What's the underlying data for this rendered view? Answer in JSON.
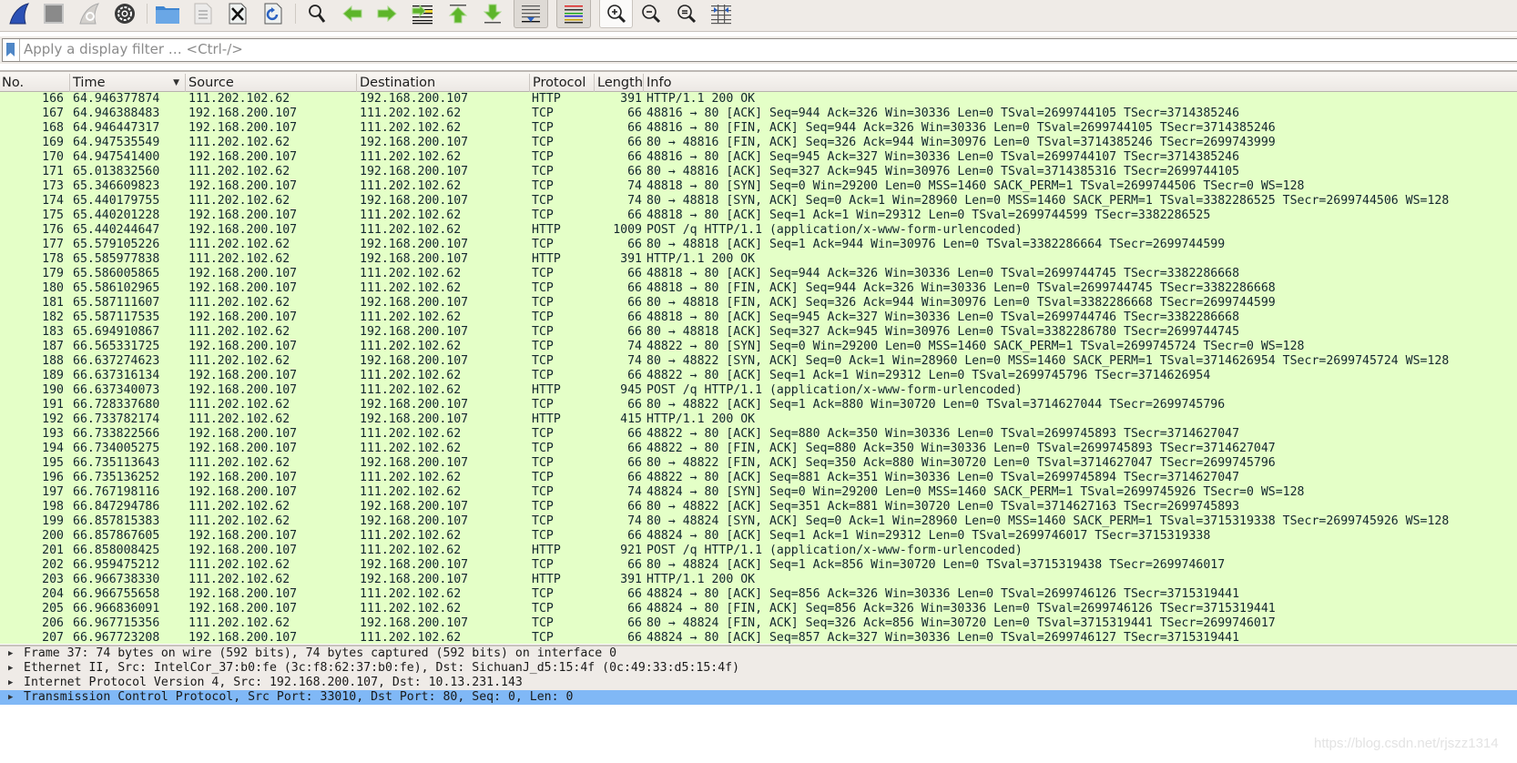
{
  "toolbar": {
    "buttons": [
      {
        "name": "start-capture",
        "icon": "shark-fin-icon"
      },
      {
        "name": "stop-capture",
        "icon": "stop-square-icon"
      },
      {
        "name": "restart-capture",
        "icon": "restart-fin-icon"
      },
      {
        "name": "capture-options",
        "icon": "gear-icon"
      },
      {
        "name": "open-file",
        "icon": "folder-icon"
      },
      {
        "name": "save-file",
        "icon": "binary-file-icon"
      },
      {
        "name": "close-file",
        "icon": "close-file-icon"
      },
      {
        "name": "reload-file",
        "icon": "reload-file-icon"
      },
      {
        "name": "find-packet",
        "icon": "search-icon"
      },
      {
        "name": "go-back",
        "icon": "arrow-left-icon"
      },
      {
        "name": "go-forward",
        "icon": "arrow-right-icon"
      },
      {
        "name": "go-to-packet",
        "icon": "goto-packet-icon"
      },
      {
        "name": "go-first",
        "icon": "arrow-up-icon"
      },
      {
        "name": "go-last",
        "icon": "arrow-down-icon"
      },
      {
        "name": "auto-scroll",
        "icon": "autoscroll-icon"
      },
      {
        "name": "colorize",
        "icon": "colorize-lines-icon"
      },
      {
        "name": "zoom-in",
        "icon": "zoom-in-icon"
      },
      {
        "name": "zoom-out",
        "icon": "zoom-out-icon"
      },
      {
        "name": "normal-size",
        "icon": "zoom-reset-icon"
      },
      {
        "name": "resize-columns",
        "icon": "resize-columns-icon"
      }
    ]
  },
  "filter": {
    "placeholder": "Apply a display filter … <Ctrl-/>",
    "value": ""
  },
  "packet_list": {
    "columns": [
      "No.",
      "Time",
      "Source",
      "Destination",
      "Protocol",
      "Length",
      "Info"
    ],
    "sort_column": "Time",
    "row_color": "#e4ffc7",
    "rows": [
      {
        "no": "166",
        "time": "64.946377874",
        "src": "111.202.102.62",
        "dst": "192.168.200.107",
        "proto": "HTTP",
        "len": "391",
        "info": "HTTP/1.1 200 OK"
      },
      {
        "no": "167",
        "time": "64.946388483",
        "src": "192.168.200.107",
        "dst": "111.202.102.62",
        "proto": "TCP",
        "len": "66",
        "info": "48816 → 80 [ACK] Seq=944 Ack=326 Win=30336 Len=0 TSval=2699744105 TSecr=3714385246"
      },
      {
        "no": "168",
        "time": "64.946447317",
        "src": "192.168.200.107",
        "dst": "111.202.102.62",
        "proto": "TCP",
        "len": "66",
        "info": "48816 → 80 [FIN, ACK] Seq=944 Ack=326 Win=30336 Len=0 TSval=2699744105 TSecr=3714385246"
      },
      {
        "no": "169",
        "time": "64.947535549",
        "src": "111.202.102.62",
        "dst": "192.168.200.107",
        "proto": "TCP",
        "len": "66",
        "info": "80 → 48816 [FIN, ACK] Seq=326 Ack=944 Win=30976 Len=0 TSval=3714385246 TSecr=2699743999"
      },
      {
        "no": "170",
        "time": "64.947541400",
        "src": "192.168.200.107",
        "dst": "111.202.102.62",
        "proto": "TCP",
        "len": "66",
        "info": "48816 → 80 [ACK] Seq=945 Ack=327 Win=30336 Len=0 TSval=2699744107 TSecr=3714385246"
      },
      {
        "no": "171",
        "time": "65.013832560",
        "src": "111.202.102.62",
        "dst": "192.168.200.107",
        "proto": "TCP",
        "len": "66",
        "info": "80 → 48816 [ACK] Seq=327 Ack=945 Win=30976 Len=0 TSval=3714385316 TSecr=2699744105"
      },
      {
        "no": "173",
        "time": "65.346609823",
        "src": "192.168.200.107",
        "dst": "111.202.102.62",
        "proto": "TCP",
        "len": "74",
        "info": "48818 → 80 [SYN] Seq=0 Win=29200 Len=0 MSS=1460 SACK_PERM=1 TSval=2699744506 TSecr=0 WS=128"
      },
      {
        "no": "174",
        "time": "65.440179755",
        "src": "111.202.102.62",
        "dst": "192.168.200.107",
        "proto": "TCP",
        "len": "74",
        "info": "80 → 48818 [SYN, ACK] Seq=0 Ack=1 Win=28960 Len=0 MSS=1460 SACK_PERM=1 TSval=3382286525 TSecr=2699744506 WS=128"
      },
      {
        "no": "175",
        "time": "65.440201228",
        "src": "192.168.200.107",
        "dst": "111.202.102.62",
        "proto": "TCP",
        "len": "66",
        "info": "48818 → 80 [ACK] Seq=1 Ack=1 Win=29312 Len=0 TSval=2699744599 TSecr=3382286525"
      },
      {
        "no": "176",
        "time": "65.440244647",
        "src": "192.168.200.107",
        "dst": "111.202.102.62",
        "proto": "HTTP",
        "len": "1009",
        "info": "POST /q HTTP/1.1  (application/x-www-form-urlencoded)"
      },
      {
        "no": "177",
        "time": "65.579105226",
        "src": "111.202.102.62",
        "dst": "192.168.200.107",
        "proto": "TCP",
        "len": "66",
        "info": "80 → 48818 [ACK] Seq=1 Ack=944 Win=30976 Len=0 TSval=3382286664 TSecr=2699744599"
      },
      {
        "no": "178",
        "time": "65.585977838",
        "src": "111.202.102.62",
        "dst": "192.168.200.107",
        "proto": "HTTP",
        "len": "391",
        "info": "HTTP/1.1 200 OK"
      },
      {
        "no": "179",
        "time": "65.586005865",
        "src": "192.168.200.107",
        "dst": "111.202.102.62",
        "proto": "TCP",
        "len": "66",
        "info": "48818 → 80 [ACK] Seq=944 Ack=326 Win=30336 Len=0 TSval=2699744745 TSecr=3382286668"
      },
      {
        "no": "180",
        "time": "65.586102965",
        "src": "192.168.200.107",
        "dst": "111.202.102.62",
        "proto": "TCP",
        "len": "66",
        "info": "48818 → 80 [FIN, ACK] Seq=944 Ack=326 Win=30336 Len=0 TSval=2699744745 TSecr=3382286668"
      },
      {
        "no": "181",
        "time": "65.587111607",
        "src": "111.202.102.62",
        "dst": "192.168.200.107",
        "proto": "TCP",
        "len": "66",
        "info": "80 → 48818 [FIN, ACK] Seq=326 Ack=944 Win=30976 Len=0 TSval=3382286668 TSecr=2699744599"
      },
      {
        "no": "182",
        "time": "65.587117535",
        "src": "192.168.200.107",
        "dst": "111.202.102.62",
        "proto": "TCP",
        "len": "66",
        "info": "48818 → 80 [ACK] Seq=945 Ack=327 Win=30336 Len=0 TSval=2699744746 TSecr=3382286668"
      },
      {
        "no": "183",
        "time": "65.694910867",
        "src": "111.202.102.62",
        "dst": "192.168.200.107",
        "proto": "TCP",
        "len": "66",
        "info": "80 → 48818 [ACK] Seq=327 Ack=945 Win=30976 Len=0 TSval=3382286780 TSecr=2699744745"
      },
      {
        "no": "187",
        "time": "66.565331725",
        "src": "192.168.200.107",
        "dst": "111.202.102.62",
        "proto": "TCP",
        "len": "74",
        "info": "48822 → 80 [SYN] Seq=0 Win=29200 Len=0 MSS=1460 SACK_PERM=1 TSval=2699745724 TSecr=0 WS=128"
      },
      {
        "no": "188",
        "time": "66.637274623",
        "src": "111.202.102.62",
        "dst": "192.168.200.107",
        "proto": "TCP",
        "len": "74",
        "info": "80 → 48822 [SYN, ACK] Seq=0 Ack=1 Win=28960 Len=0 MSS=1460 SACK_PERM=1 TSval=3714626954 TSecr=2699745724 WS=128"
      },
      {
        "no": "189",
        "time": "66.637316134",
        "src": "192.168.200.107",
        "dst": "111.202.102.62",
        "proto": "TCP",
        "len": "66",
        "info": "48822 → 80 [ACK] Seq=1 Ack=1 Win=29312 Len=0 TSval=2699745796 TSecr=3714626954"
      },
      {
        "no": "190",
        "time": "66.637340073",
        "src": "192.168.200.107",
        "dst": "111.202.102.62",
        "proto": "HTTP",
        "len": "945",
        "info": "POST /q HTTP/1.1  (application/x-www-form-urlencoded)"
      },
      {
        "no": "191",
        "time": "66.728337680",
        "src": "111.202.102.62",
        "dst": "192.168.200.107",
        "proto": "TCP",
        "len": "66",
        "info": "80 → 48822 [ACK] Seq=1 Ack=880 Win=30720 Len=0 TSval=3714627044 TSecr=2699745796"
      },
      {
        "no": "192",
        "time": "66.733782174",
        "src": "111.202.102.62",
        "dst": "192.168.200.107",
        "proto": "HTTP",
        "len": "415",
        "info": "HTTP/1.1 200 OK"
      },
      {
        "no": "193",
        "time": "66.733822566",
        "src": "192.168.200.107",
        "dst": "111.202.102.62",
        "proto": "TCP",
        "len": "66",
        "info": "48822 → 80 [ACK] Seq=880 Ack=350 Win=30336 Len=0 TSval=2699745893 TSecr=3714627047"
      },
      {
        "no": "194",
        "time": "66.734005275",
        "src": "192.168.200.107",
        "dst": "111.202.102.62",
        "proto": "TCP",
        "len": "66",
        "info": "48822 → 80 [FIN, ACK] Seq=880 Ack=350 Win=30336 Len=0 TSval=2699745893 TSecr=3714627047"
      },
      {
        "no": "195",
        "time": "66.735113643",
        "src": "111.202.102.62",
        "dst": "192.168.200.107",
        "proto": "TCP",
        "len": "66",
        "info": "80 → 48822 [FIN, ACK] Seq=350 Ack=880 Win=30720 Len=0 TSval=3714627047 TSecr=2699745796"
      },
      {
        "no": "196",
        "time": "66.735136252",
        "src": "192.168.200.107",
        "dst": "111.202.102.62",
        "proto": "TCP",
        "len": "66",
        "info": "48822 → 80 [ACK] Seq=881 Ack=351 Win=30336 Len=0 TSval=2699745894 TSecr=3714627047"
      },
      {
        "no": "197",
        "time": "66.767198116",
        "src": "192.168.200.107",
        "dst": "111.202.102.62",
        "proto": "TCP",
        "len": "74",
        "info": "48824 → 80 [SYN] Seq=0 Win=29200 Len=0 MSS=1460 SACK_PERM=1 TSval=2699745926 TSecr=0 WS=128"
      },
      {
        "no": "198",
        "time": "66.847294786",
        "src": "111.202.102.62",
        "dst": "192.168.200.107",
        "proto": "TCP",
        "len": "66",
        "info": "80 → 48822 [ACK] Seq=351 Ack=881 Win=30720 Len=0 TSval=3714627163 TSecr=2699745893"
      },
      {
        "no": "199",
        "time": "66.857815383",
        "src": "111.202.102.62",
        "dst": "192.168.200.107",
        "proto": "TCP",
        "len": "74",
        "info": "80 → 48824 [SYN, ACK] Seq=0 Ack=1 Win=28960 Len=0 MSS=1460 SACK_PERM=1 TSval=3715319338 TSecr=2699745926 WS=128"
      },
      {
        "no": "200",
        "time": "66.857867605",
        "src": "192.168.200.107",
        "dst": "111.202.102.62",
        "proto": "TCP",
        "len": "66",
        "info": "48824 → 80 [ACK] Seq=1 Ack=1 Win=29312 Len=0 TSval=2699746017 TSecr=3715319338"
      },
      {
        "no": "201",
        "time": "66.858008425",
        "src": "192.168.200.107",
        "dst": "111.202.102.62",
        "proto": "HTTP",
        "len": "921",
        "info": "POST /q HTTP/1.1  (application/x-www-form-urlencoded)"
      },
      {
        "no": "202",
        "time": "66.959475212",
        "src": "111.202.102.62",
        "dst": "192.168.200.107",
        "proto": "TCP",
        "len": "66",
        "info": "80 → 48824 [ACK] Seq=1 Ack=856 Win=30720 Len=0 TSval=3715319438 TSecr=2699746017"
      },
      {
        "no": "203",
        "time": "66.966738330",
        "src": "111.202.102.62",
        "dst": "192.168.200.107",
        "proto": "HTTP",
        "len": "391",
        "info": "HTTP/1.1 200 OK"
      },
      {
        "no": "204",
        "time": "66.966755658",
        "src": "192.168.200.107",
        "dst": "111.202.102.62",
        "proto": "TCP",
        "len": "66",
        "info": "48824 → 80 [ACK] Seq=856 Ack=326 Win=30336 Len=0 TSval=2699746126 TSecr=3715319441"
      },
      {
        "no": "205",
        "time": "66.966836091",
        "src": "192.168.200.107",
        "dst": "111.202.102.62",
        "proto": "TCP",
        "len": "66",
        "info": "48824 → 80 [FIN, ACK] Seq=856 Ack=326 Win=30336 Len=0 TSval=2699746126 TSecr=3715319441"
      },
      {
        "no": "206",
        "time": "66.967715356",
        "src": "111.202.102.62",
        "dst": "192.168.200.107",
        "proto": "TCP",
        "len": "66",
        "info": "80 → 48824 [FIN, ACK] Seq=326 Ack=856 Win=30720 Len=0 TSval=3715319441 TSecr=2699746017"
      },
      {
        "no": "207",
        "time": "66.967723208",
        "src": "192.168.200.107",
        "dst": "111.202.102.62",
        "proto": "TCP",
        "len": "66",
        "info": "48824 → 80 [ACK] Seq=857 Ack=327 Win=30336 Len=0 TSval=2699746127 TSecr=3715319441"
      }
    ]
  },
  "packet_details": {
    "items": [
      {
        "text": "Frame 37: 74 bytes on wire (592 bits), 74 bytes captured (592 bits) on interface 0",
        "selected": false
      },
      {
        "text": "Ethernet II, Src: IntelCor_37:b0:fe (3c:f8:62:37:b0:fe), Dst: SichuanJ_d5:15:4f (0c:49:33:d5:15:4f)",
        "selected": false
      },
      {
        "text": "Internet Protocol Version 4, Src: 192.168.200.107, Dst: 10.13.231.143",
        "selected": false
      },
      {
        "text": "Transmission Control Protocol, Src Port: 33010, Dst Port: 80, Seq: 0, Len: 0",
        "selected": true
      }
    ],
    "selected_color": "#80b8f6"
  },
  "watermark": "https://blog.csdn.net/rjszz1314"
}
